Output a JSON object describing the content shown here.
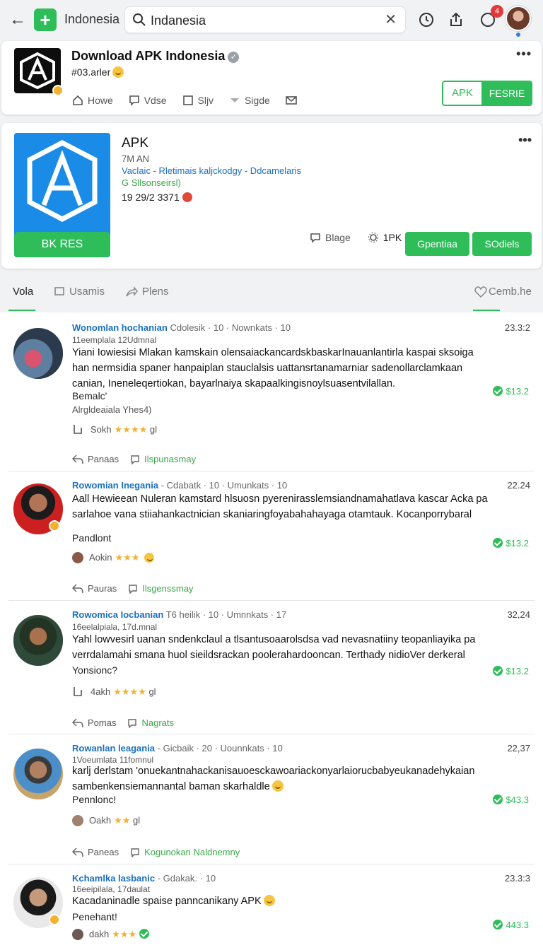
{
  "topbar": {
    "app_name": "Indonesia",
    "search_value": "Indanesia",
    "notification_count": "4"
  },
  "header_card": {
    "title": "Download APK Indonesia",
    "subtitle": "#03.arler",
    "links": [
      "Howe",
      "Vdse",
      "Sljv",
      "Sigde"
    ],
    "btn_left": "APK",
    "btn_right": "FESRIE"
  },
  "app_card": {
    "title": "APK",
    "meta": "7M AN",
    "categories": "Vaclaic - Rletimais kaljckodgy - Ddcamelaris",
    "tag": "G Sllsonseirsl)",
    "count": "19 29/2 3371",
    "install_label": "BK RES",
    "action_share": "Blage",
    "action_count": "1PK",
    "btn1": "Gpentiaa",
    "btn2": "SOdiels"
  },
  "tabs": {
    "items": [
      "Vola",
      "Usamis",
      "Plens"
    ],
    "right": "Cemb.he"
  },
  "reviews": [
    {
      "name": "Wonomlan hochanian",
      "head_rest": "Cdolesik  ·  10  ·  Nownkats  ·  10",
      "date": "11eemplala 12Udmnal",
      "body": "Yiani Iowiesisi Mlakan kamskain olensaiackancardskbaskarInauanlantirla kaspai sksoiga han nermsidia spaner hanpaiplan stauclalsis uattansrtanamarniar sadenollarclamkaan canian, Ineneleqertiokan, bayarlnaiya skapaalkingisnoylsuasentvilallan.",
      "footer1": "Bemalc'",
      "footer2": "Alrgldeaiala Yhes4)",
      "time": "23.3:2",
      "score": "$13.2",
      "rating_label": "Sokh",
      "rating_stars": "★★★★",
      "rating_tail": "gl",
      "reply": "Panaas",
      "pin": "Ilspunasmay"
    },
    {
      "name": "Rowomian Inegania",
      "head_rest": "-  Cdabatk  ·  10  ·  Umunkats  ·  10",
      "date": "",
      "body": "Aall Hewieean  Nuleran kamstard hlsuosn pyerenirasslemsiandnamahatlava kascar Acka pa sarlahoe vana stiiahankactnician skaniaringfoyabahahayaga otamtauk. Kocanporrybaral",
      "footer1": "Pandlont",
      "footer2": "",
      "time": "22.24",
      "score": "$13.2",
      "rating_label": "Aokin",
      "rating_stars": "★★★",
      "rating_tail": "",
      "reply": "Pauras",
      "pin": "Ilsgenssmay"
    },
    {
      "name": "Rowomica Iocbanian",
      "head_rest": "T6 heilik  ·  10  ·  Umnnkats  ·  17",
      "date": "16eelalpiala, 17d.mnal",
      "body": "Yahl lowvesirl uanan sndenkclaul a tlsantusoaarolsdsa vad nevasnatiiny teopanliayika pa verrdalamahi smana huol sieildsrackan poolerahardooncan. Terthady nidioVer derkeral",
      "footer1": "Yonsionc?",
      "footer2": "",
      "time": "32,24",
      "score": "$13.2",
      "rating_label": "4akh",
      "rating_stars": "★★★★",
      "rating_tail": "gl",
      "reply": "Pomas",
      "pin": "Nagrats"
    },
    {
      "name": "Rowanlan leagania",
      "head_rest": "-  Gicbaik  ·  20  ·  Uounnkats  ·  10",
      "date": "1Voeumlata 11fomnul",
      "body": "karlj derlstam 'onuekantnahackanisauoesckawoariackonyarlaiorucbabyeukanadehykaian sambenkensiemannantal baman skarhaldle",
      "footer1": "Pennlonc!",
      "footer2": "",
      "time": "22,37",
      "score": "$43.3",
      "rating_label": "Oakh",
      "rating_stars": "★★",
      "rating_tail": "gl",
      "reply": "Paneas",
      "pin": "Kogunokan Naldnemny"
    },
    {
      "name": "Kchamlka lasbanic",
      "head_rest": "-  Gdakak.  ·  10",
      "date": "16eeipilala, 17daulat",
      "body": "Kacadaninadle spaise panncanikany APK",
      "footer1": "Penehant!",
      "footer2": "",
      "time": "23.3:3",
      "score": "443.3",
      "rating_label": "dakh",
      "rating_stars": "★★★",
      "rating_tail": "",
      "reply": "",
      "pin": ""
    }
  ],
  "colors": {
    "accent_green": "#2ebd59",
    "link_blue": "#1a6fc2",
    "star_yellow": "#f2b230",
    "app_icon_blue": "#1a8ce8"
  }
}
